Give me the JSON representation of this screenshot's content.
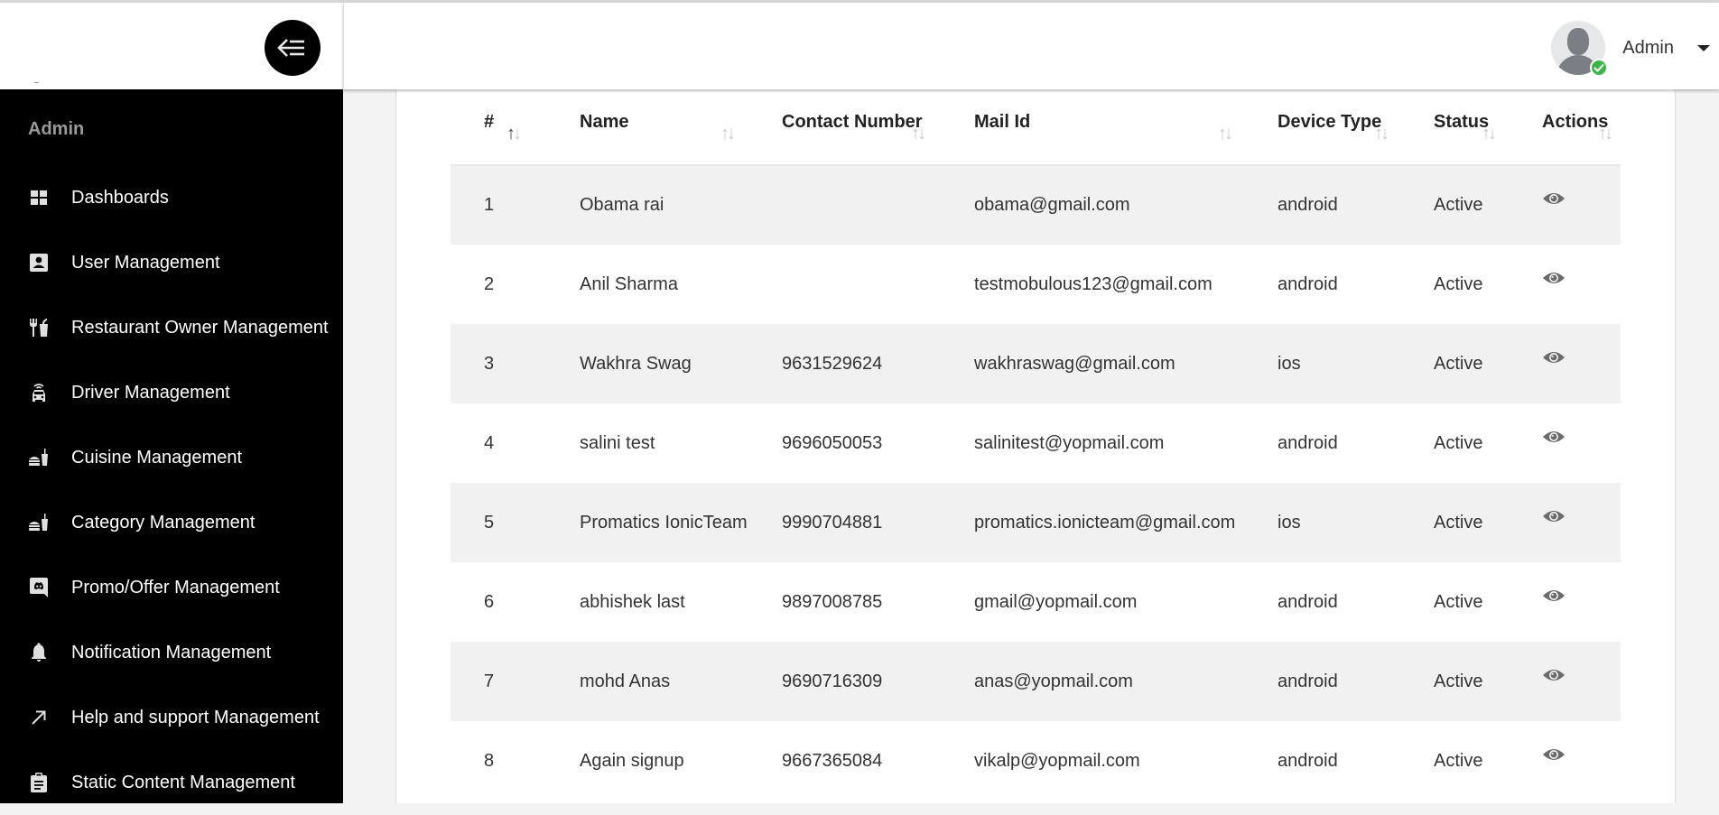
{
  "sidebar": {
    "role_label": "Admin",
    "toggle_icon": "arrow-left-lines-icon",
    "items": [
      {
        "label": "Dashboards",
        "icon": "grid-icon"
      },
      {
        "label": "User Management",
        "icon": "user-card-icon"
      },
      {
        "label": "Restaurant Owner Management",
        "icon": "fork-knife-cup-icon"
      },
      {
        "label": "Driver Management",
        "icon": "taxi-icon"
      },
      {
        "label": "Cuisine Management",
        "icon": "burger-drink-icon"
      },
      {
        "label": "Category Management",
        "icon": "burger-drink-icon"
      },
      {
        "label": "Promo/Offer Management",
        "icon": "discord-icon"
      },
      {
        "label": "Notification Management",
        "icon": "bell-icon"
      },
      {
        "label": "Help and support Management",
        "icon": "arrow-up-right-icon"
      },
      {
        "label": "Static Content Management",
        "icon": "clipboard-icon"
      }
    ]
  },
  "header": {
    "user_name": "Admin",
    "status": "online"
  },
  "table": {
    "columns": [
      "#",
      "Name",
      "Contact Number",
      "Mail Id",
      "Device Type",
      "Status",
      "Actions"
    ],
    "rows": [
      {
        "no": "1",
        "name": "Obama rai",
        "contact": "",
        "mail": "obama@gmail.com",
        "device": "android",
        "status": "Active"
      },
      {
        "no": "2",
        "name": "Anil Sharma",
        "contact": "",
        "mail": "testmobulous123@gmail.com",
        "device": "android",
        "status": "Active"
      },
      {
        "no": "3",
        "name": "Wakhra Swag",
        "contact": "9631529624",
        "mail": "wakhraswag@gmail.com",
        "device": "ios",
        "status": "Active"
      },
      {
        "no": "4",
        "name": "salini test",
        "contact": "9696050053",
        "mail": "salinitest@yopmail.com",
        "device": "android",
        "status": "Active"
      },
      {
        "no": "5",
        "name": "Promatics IonicTeam",
        "contact": "9990704881",
        "mail": "promatics.ionicteam@gmail.com",
        "device": "ios",
        "status": "Active"
      },
      {
        "no": "6",
        "name": "abhishek last",
        "contact": "9897008785",
        "mail": "gmail@yopmail.com",
        "device": "android",
        "status": "Active"
      },
      {
        "no": "7",
        "name": "mohd Anas",
        "contact": "9690716309",
        "mail": "anas@yopmail.com",
        "device": "android",
        "status": "Active"
      },
      {
        "no": "8",
        "name": "Again signup",
        "contact": "9667365084",
        "mail": "vikalp@yopmail.com",
        "device": "android",
        "status": "Active"
      }
    ],
    "action_icon": "eye-icon",
    "sort_active_column": "#",
    "sort_direction": "ascending"
  },
  "colors": {
    "sidebar_bg": "#000000",
    "row_alt_bg": "#f1f1f1",
    "online_badge": "#3cb44a",
    "page_bg": "#f3f3f3"
  }
}
